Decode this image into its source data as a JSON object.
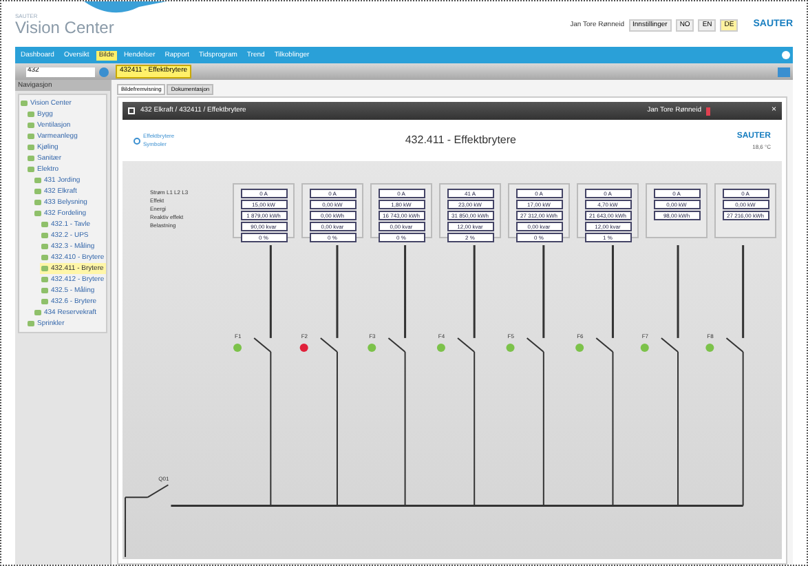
{
  "header": {
    "logo_small": "SAUTER",
    "logo": "Vision Center",
    "user": "Jan Tore Rønneid",
    "buttons": [
      {
        "label": "Innstillinger",
        "selected": false
      },
      {
        "label": "NO",
        "selected": false
      },
      {
        "label": "EN",
        "selected": false
      },
      {
        "label": "DE",
        "selected": true
      }
    ],
    "brand": "SAUTER"
  },
  "menu": [
    {
      "label": "Dashboard",
      "selected": false
    },
    {
      "label": "Oversikt",
      "selected": false
    },
    {
      "label": "Bilde",
      "selected": true
    },
    {
      "label": "Hendelser",
      "selected": false
    },
    {
      "label": "Rapport",
      "selected": false
    },
    {
      "label": "Tidsprogram",
      "selected": false
    },
    {
      "label": "Trend",
      "selected": false
    },
    {
      "label": "Tilkoblinger",
      "selected": false
    }
  ],
  "toolbar": {
    "search": "432",
    "tab": "432411 - Effektbrytere"
  },
  "sidebar": {
    "title": "Navigasjon",
    "tree": [
      {
        "label": "Vision Center",
        "selected": false,
        "children": [
          {
            "label": "Bygg",
            "selected": false
          },
          {
            "label": "Ventilasjon",
            "selected": false
          },
          {
            "label": "Varmeanlegg",
            "selected": false
          },
          {
            "label": "Kjøling",
            "selected": false
          },
          {
            "label": "Sanitær",
            "selected": false
          },
          {
            "label": "Elektro",
            "selected": false,
            "children": [
              {
                "label": "431 Jording",
                "selected": false
              },
              {
                "label": "432 Elkraft",
                "selected": false
              },
              {
                "label": "433 Belysning",
                "selected": false
              },
              {
                "label": "432 Fordeling",
                "selected": false,
                "children": [
                  {
                    "label": "432.1 - Tavle",
                    "selected": false
                  },
                  {
                    "label": "432.2 - UPS",
                    "selected": false
                  },
                  {
                    "label": "432.3 - Måling",
                    "selected": false
                  },
                  {
                    "label": "432.410 - Brytere",
                    "selected": false
                  },
                  {
                    "label": "432.411 - Brytere",
                    "selected": true
                  },
                  {
                    "label": "432.412 - Brytere",
                    "selected": false
                  },
                  {
                    "label": "432.5 - Måling",
                    "selected": false
                  },
                  {
                    "label": "432.6 - Brytere",
                    "selected": false
                  }
                ]
              },
              {
                "label": "434 Reservekraft",
                "selected": false
              }
            ]
          },
          {
            "label": "Sprinkler",
            "selected": false
          }
        ]
      }
    ]
  },
  "tabs": [
    {
      "label": "Bildefremvisning",
      "selected": true
    },
    {
      "label": "Dokumentasjon",
      "selected": false
    }
  ],
  "panel": {
    "breadcrumb": "432 Elkraft / 432411 / Effektbrytere",
    "user": "Jan Tore Rønneid",
    "close": "×",
    "legend": "Effektbrytere Symboler",
    "title": "432.411 - Effektbrytere",
    "brand": "SAUTER",
    "temperature": "18,6 °C"
  },
  "row_labels": [
    "Strøm L1 L2 L3",
    "Effekt",
    "Energi",
    "Reaktiv effekt",
    "Belastning"
  ],
  "feeders": [
    {
      "values": [
        "0 A",
        "15,00 kW",
        "1 879,00 kWh",
        "90,00 kvar",
        "0 %"
      ],
      "label": "F1",
      "closed": false,
      "color": "#7cc24a"
    },
    {
      "values": [
        "0 A",
        "0,00 kW",
        "0,00 kWh",
        "0,00 kvar",
        "0 %"
      ],
      "label": "F2",
      "closed": false,
      "color": "#e0203a"
    },
    {
      "values": [
        "0 A",
        "1,80 kW",
        "16 743,00 kWh",
        "0,00 kvar",
        "0 %"
      ],
      "label": "F3",
      "closed": false,
      "color": "#7cc24a"
    },
    {
      "values": [
        "41 A",
        "23,00 kW",
        "31 850,00 kWh",
        "12,00 kvar",
        "2 %"
      ],
      "label": "F4",
      "closed": false,
      "color": "#7cc24a"
    },
    {
      "values": [
        "0 A",
        "17,00 kW",
        "27 312,00 kWh",
        "0,00 kvar",
        "0 %"
      ],
      "label": "F5",
      "closed": false,
      "color": "#7cc24a"
    },
    {
      "values": [
        "0 A",
        "4,70 kW",
        "21 643,00 kWh",
        "12,00 kvar",
        "1 %"
      ],
      "label": "F6",
      "closed": false,
      "color": "#7cc24a"
    },
    {
      "values": [
        "0 A",
        "0,00 kW",
        "98,00 kWh"
      ],
      "label": "F7",
      "closed": false,
      "color": "#7cc24a"
    },
    {
      "values": [
        "0 A",
        "0,00 kW",
        "27 216,00 kWh"
      ],
      "label": "F8",
      "closed": false,
      "color": "#7cc24a"
    }
  ],
  "main_breaker": {
    "label": "Q01"
  }
}
